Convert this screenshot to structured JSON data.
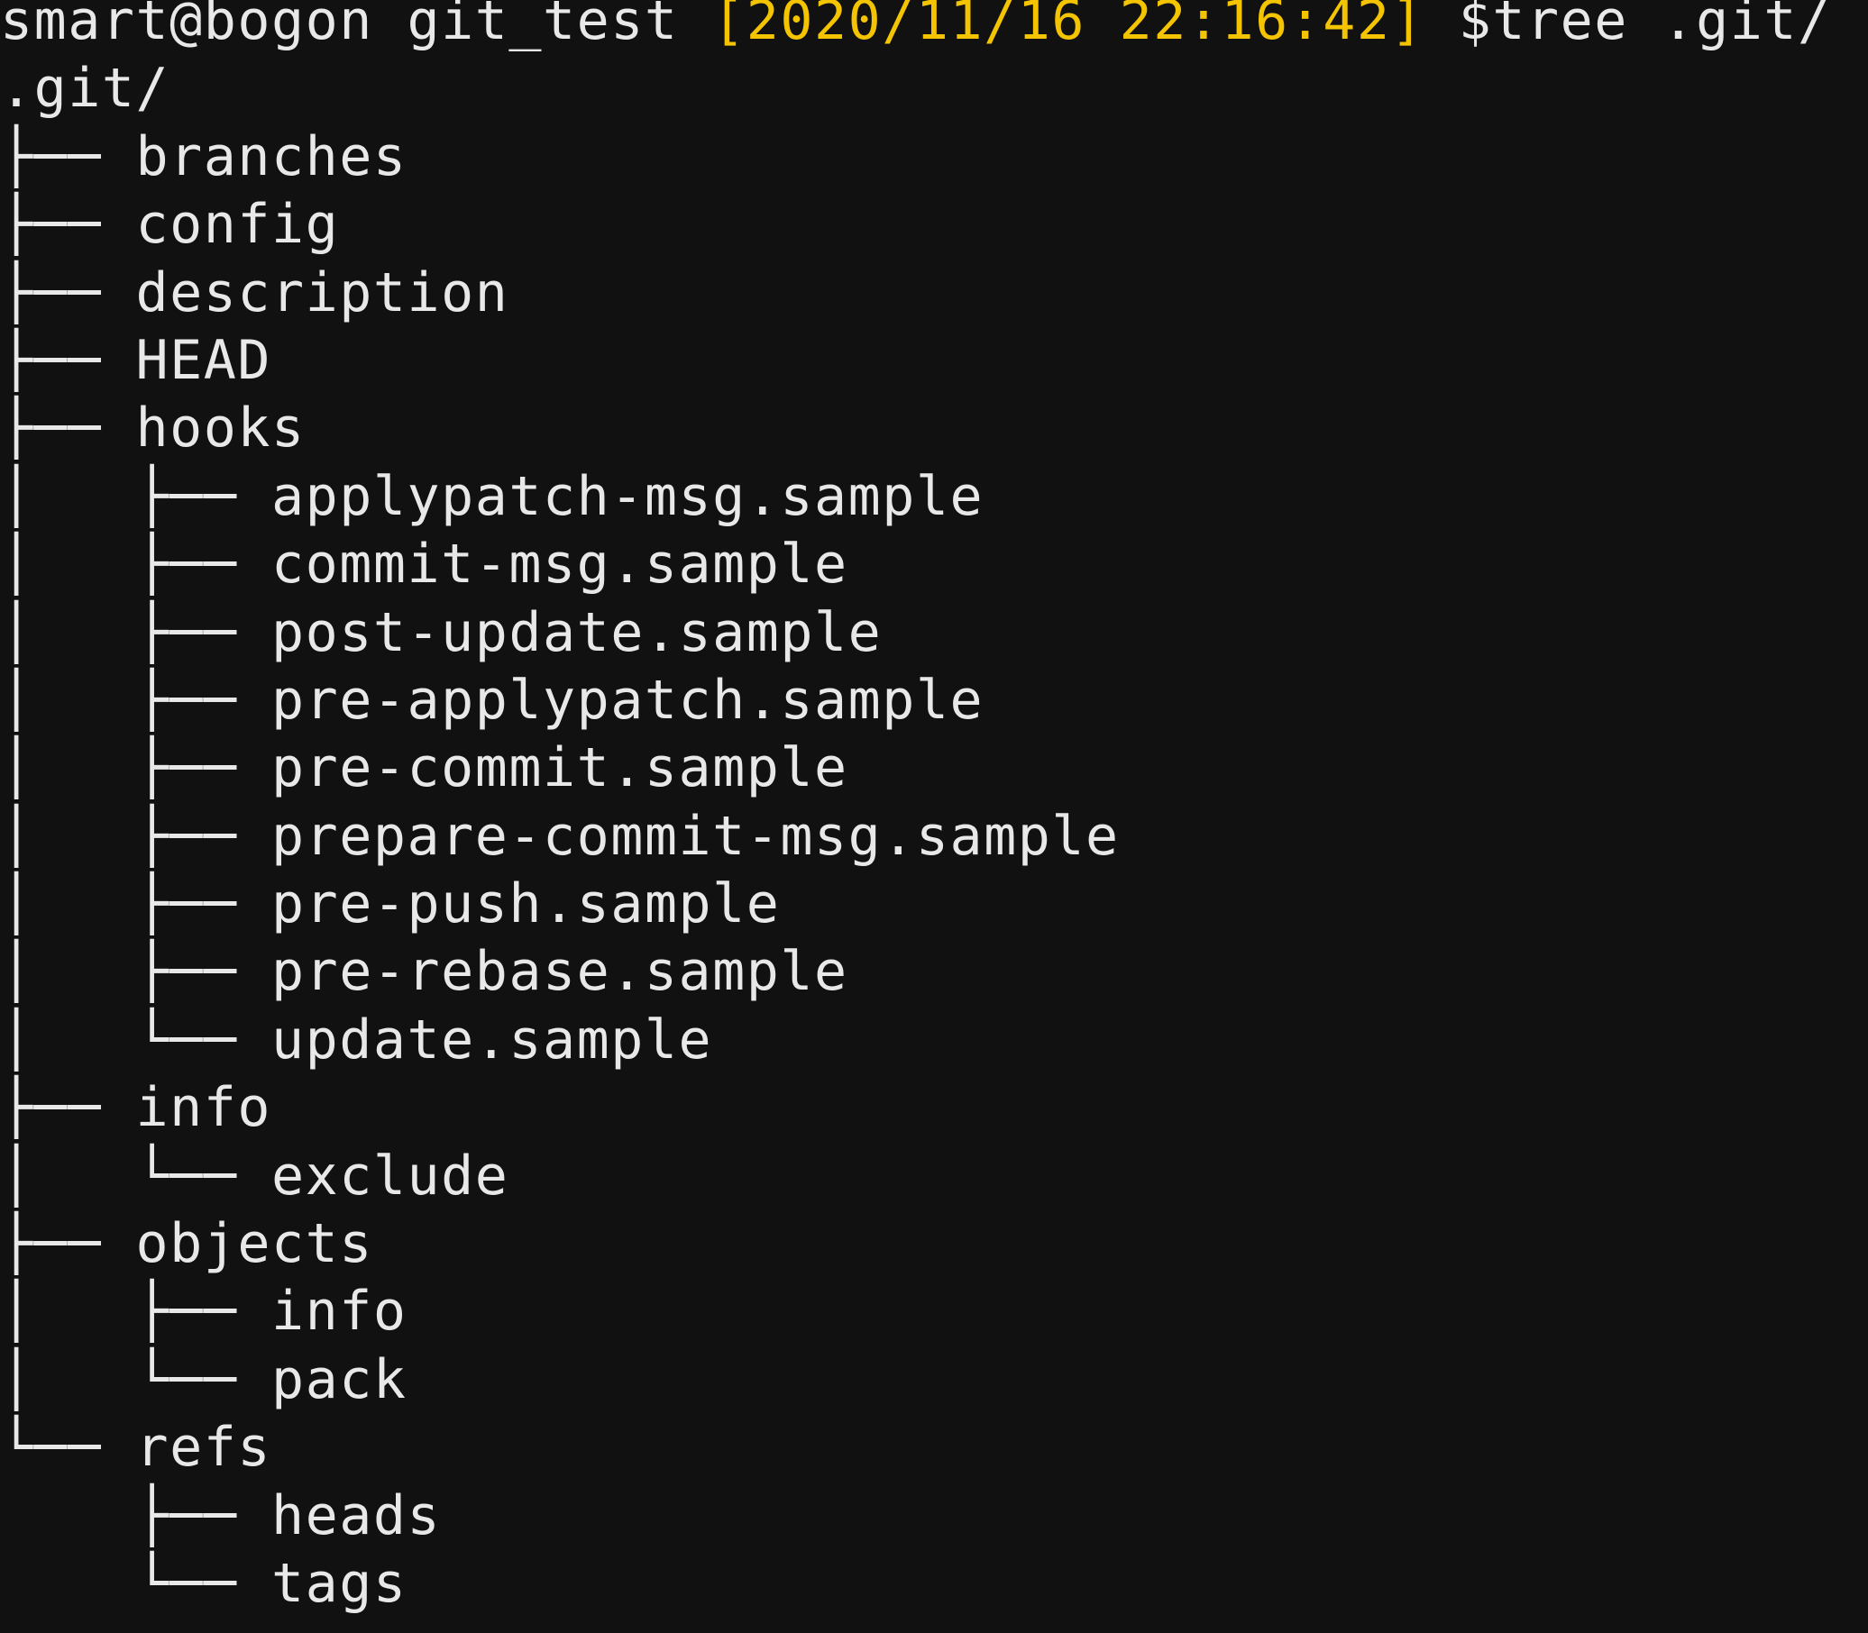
{
  "prompt": {
    "user_host_dir": "smart@bogon git_test ",
    "timestamp": "[2020/11/16 22:16:42]",
    "command": " $tree .git/"
  },
  "output": [
    ".git/",
    "├── branches",
    "├── config",
    "├── description",
    "├── HEAD",
    "├── hooks",
    "│   ├── applypatch-msg.sample",
    "│   ├── commit-msg.sample",
    "│   ├── post-update.sample",
    "│   ├── pre-applypatch.sample",
    "│   ├── pre-commit.sample",
    "│   ├── prepare-commit-msg.sample",
    "│   ├── pre-push.sample",
    "│   ├── pre-rebase.sample",
    "│   └── update.sample",
    "├── info",
    "│   └── exclude",
    "├── objects",
    "│   ├── info",
    "│   └── pack",
    "└── refs",
    "    ├── heads",
    "    └── tags"
  ],
  "colors": {
    "background": "#111111",
    "text": "#e8e8e8",
    "timestamp": "#f5c400"
  }
}
